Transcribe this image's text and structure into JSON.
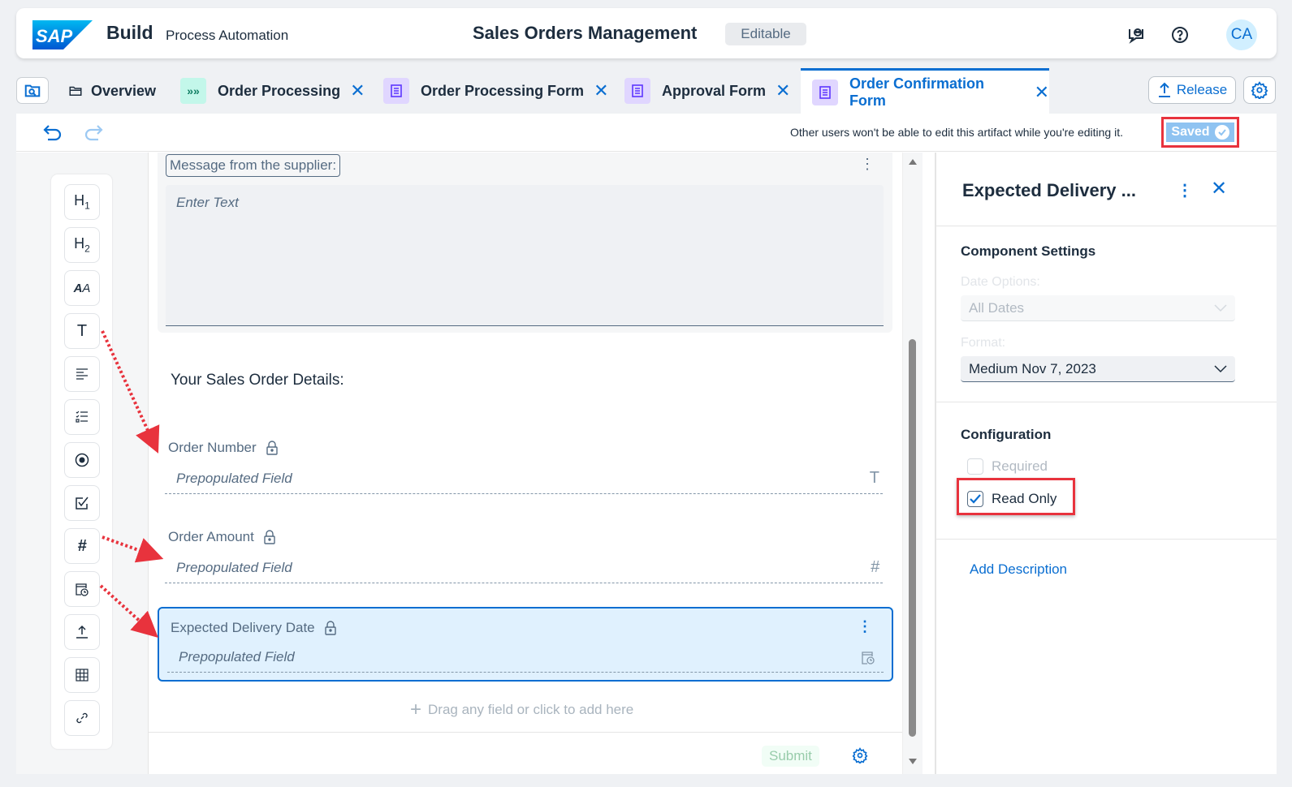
{
  "shell": {
    "brand": "Build",
    "product": "Process Automation",
    "project_title": "Sales Orders Management",
    "status_badge": "Editable",
    "avatar_initials": "CA",
    "icons": [
      "feedback-icon",
      "help-icon"
    ]
  },
  "tabs": [
    {
      "label": "Overview",
      "icon": "folder-icon",
      "closable": false,
      "active": false
    },
    {
      "label": "Order Processing",
      "icon": "process-icon",
      "closable": true,
      "active": false
    },
    {
      "label": "Order Processing Form",
      "icon": "form-icon",
      "closable": true,
      "active": false
    },
    {
      "label": "Approval Form",
      "icon": "form-icon",
      "closable": true,
      "active": false
    },
    {
      "label": "Order Confirmation Form",
      "icon": "form-icon",
      "closable": true,
      "active": true
    }
  ],
  "tab_actions": {
    "release_label": "Release"
  },
  "toolbar": {
    "lock_message": "Other users won't be able to edit this artifact while you're editing it.",
    "saved_label": "Saved"
  },
  "palette": {
    "items": [
      "H1",
      "H2",
      "A",
      "T",
      "paragraph",
      "checklist",
      "radio",
      "checkbox",
      "#",
      "date",
      "upload",
      "table",
      "link"
    ]
  },
  "canvas": {
    "message_label": "Message from the supplier:",
    "message_placeholder": "Enter Text",
    "section_title": "Your Sales Order Details:",
    "fields": [
      {
        "label": "Order Number",
        "value": "Prepopulated Field",
        "type_icon": "T"
      },
      {
        "label": "Order Amount",
        "value": "Prepopulated Field",
        "type_icon": "#"
      },
      {
        "label": "Expected Delivery Date",
        "value": "Prepopulated Field",
        "type_icon": "date"
      }
    ],
    "add_here": "Drag any field or click to add here",
    "submit_label": "Submit"
  },
  "properties": {
    "title": "Expected Delivery ...",
    "component_settings_heading": "Component Settings",
    "date_options_label": "Date Options:",
    "date_options_value": "All Dates",
    "format_label": "Format:",
    "format_value": "Medium Nov 7, 2023",
    "configuration_heading": "Configuration",
    "required_label": "Required",
    "required_checked": false,
    "read_only_label": "Read Only",
    "read_only_checked": true,
    "add_description": "Add Description"
  },
  "colors": {
    "accent": "#0a6ed1",
    "highlight": "#e8333d",
    "selected_bg": "#e0f1fe"
  }
}
